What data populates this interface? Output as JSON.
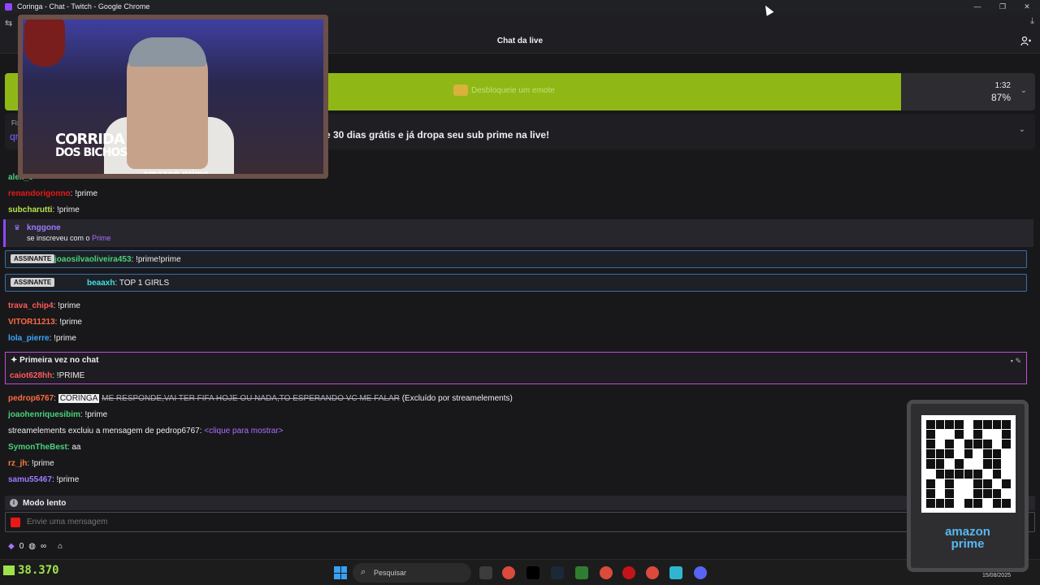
{
  "window": {
    "title": "Coringa - Chat - Twitch - Google Chrome",
    "minimize": "—",
    "maximize": "❐",
    "close": "✕"
  },
  "header": {
    "title": "Chat da live",
    "collapse_icon": "collapse-icon",
    "users_icon": "users-icon"
  },
  "hype_train": {
    "label": "Desbloqueie um emote",
    "timer": "1:32",
    "percent": "87%",
    "progress": 0.87,
    "bar_color": "#8fb816"
  },
  "pinned": {
    "label": "Fix",
    "user": "qrco",
    "message": "e 30 dias grátis e já dropa seu sub prime na live!"
  },
  "chat": [
    {
      "user": "alex_c",
      "color": "#4ad37c",
      "text": ""
    },
    {
      "user": "renandorigonno",
      "color": "#e91916",
      "text": ": !prime"
    },
    {
      "user": "subcharutti",
      "color": "#b8e34a",
      "text": ": !prime"
    }
  ],
  "sub_notice": {
    "user": "knggone",
    "text_prefix": "se inscreveu com o",
    "text_link": "Prime"
  },
  "highlighted": [
    {
      "badge": "ASSINANTE",
      "user": "joaosilvaoliveira453",
      "color": "#4ad37c",
      "text": ": !prime!prime"
    },
    {
      "badge": "ASSINANTE",
      "user": "beaaxh",
      "color": "#3ee0e8",
      "text": ": TOP 1 GIRLS"
    }
  ],
  "chat2": [
    {
      "user": "trava_chip4",
      "color": "#ff5a5a",
      "text": ": !prime"
    },
    {
      "user": "VITOR11213",
      "color": "#ff6b3d",
      "text": ": !prime"
    },
    {
      "user": "lola_pierre",
      "color": "#3da5ff",
      "text": ": !prime"
    }
  ],
  "first_chat": {
    "title": "Primeira vez no chat",
    "user": "caiot628hh",
    "color": "#ff5a5a",
    "text": ": !PRIME"
  },
  "deleted": {
    "user": "pedrop6767",
    "color": "#ff6b3d",
    "mention": "CORINGA",
    "text": "ME RESPONDE,VAI TER FIFA HOJE OU NADA,TO ESPERANDO VC ME FALAR",
    "note": "(Excluído por streamelements)"
  },
  "chat3": [
    {
      "user": "joaohenriquesibim",
      "color": "#4ad37c",
      "text": ": !prime"
    }
  ],
  "mod_notice": {
    "text": "streamelements excluiu a mensagem de pedrop6767:",
    "link": "<clique para mostrar>"
  },
  "chat4": [
    {
      "user": "SymonTheBest",
      "color": "#4ad37c",
      "text": ": aa"
    },
    {
      "user": "rz_jh",
      "color": "#ff7b3d",
      "text": ": !prime"
    },
    {
      "user": "samu55467",
      "color": "#9d7bff",
      "text": ": !prime"
    }
  ],
  "slow_mode": "Modo lento",
  "input": {
    "placeholder": "Envie uma mensagem"
  },
  "bottom": {
    "bits": "0",
    "infinity": "∞"
  },
  "overlay": {
    "corrida_line1": "CORRIDA",
    "corrida_line2": "DOS BICHOS",
    "amazon_prime": "amazon prime",
    "qr_prime_line1": "amazon",
    "qr_prime_line2": "prime"
  },
  "taskbar": {
    "views": "38.370",
    "search_placeholder": "Pesquisar",
    "date": "15/08/2025"
  }
}
